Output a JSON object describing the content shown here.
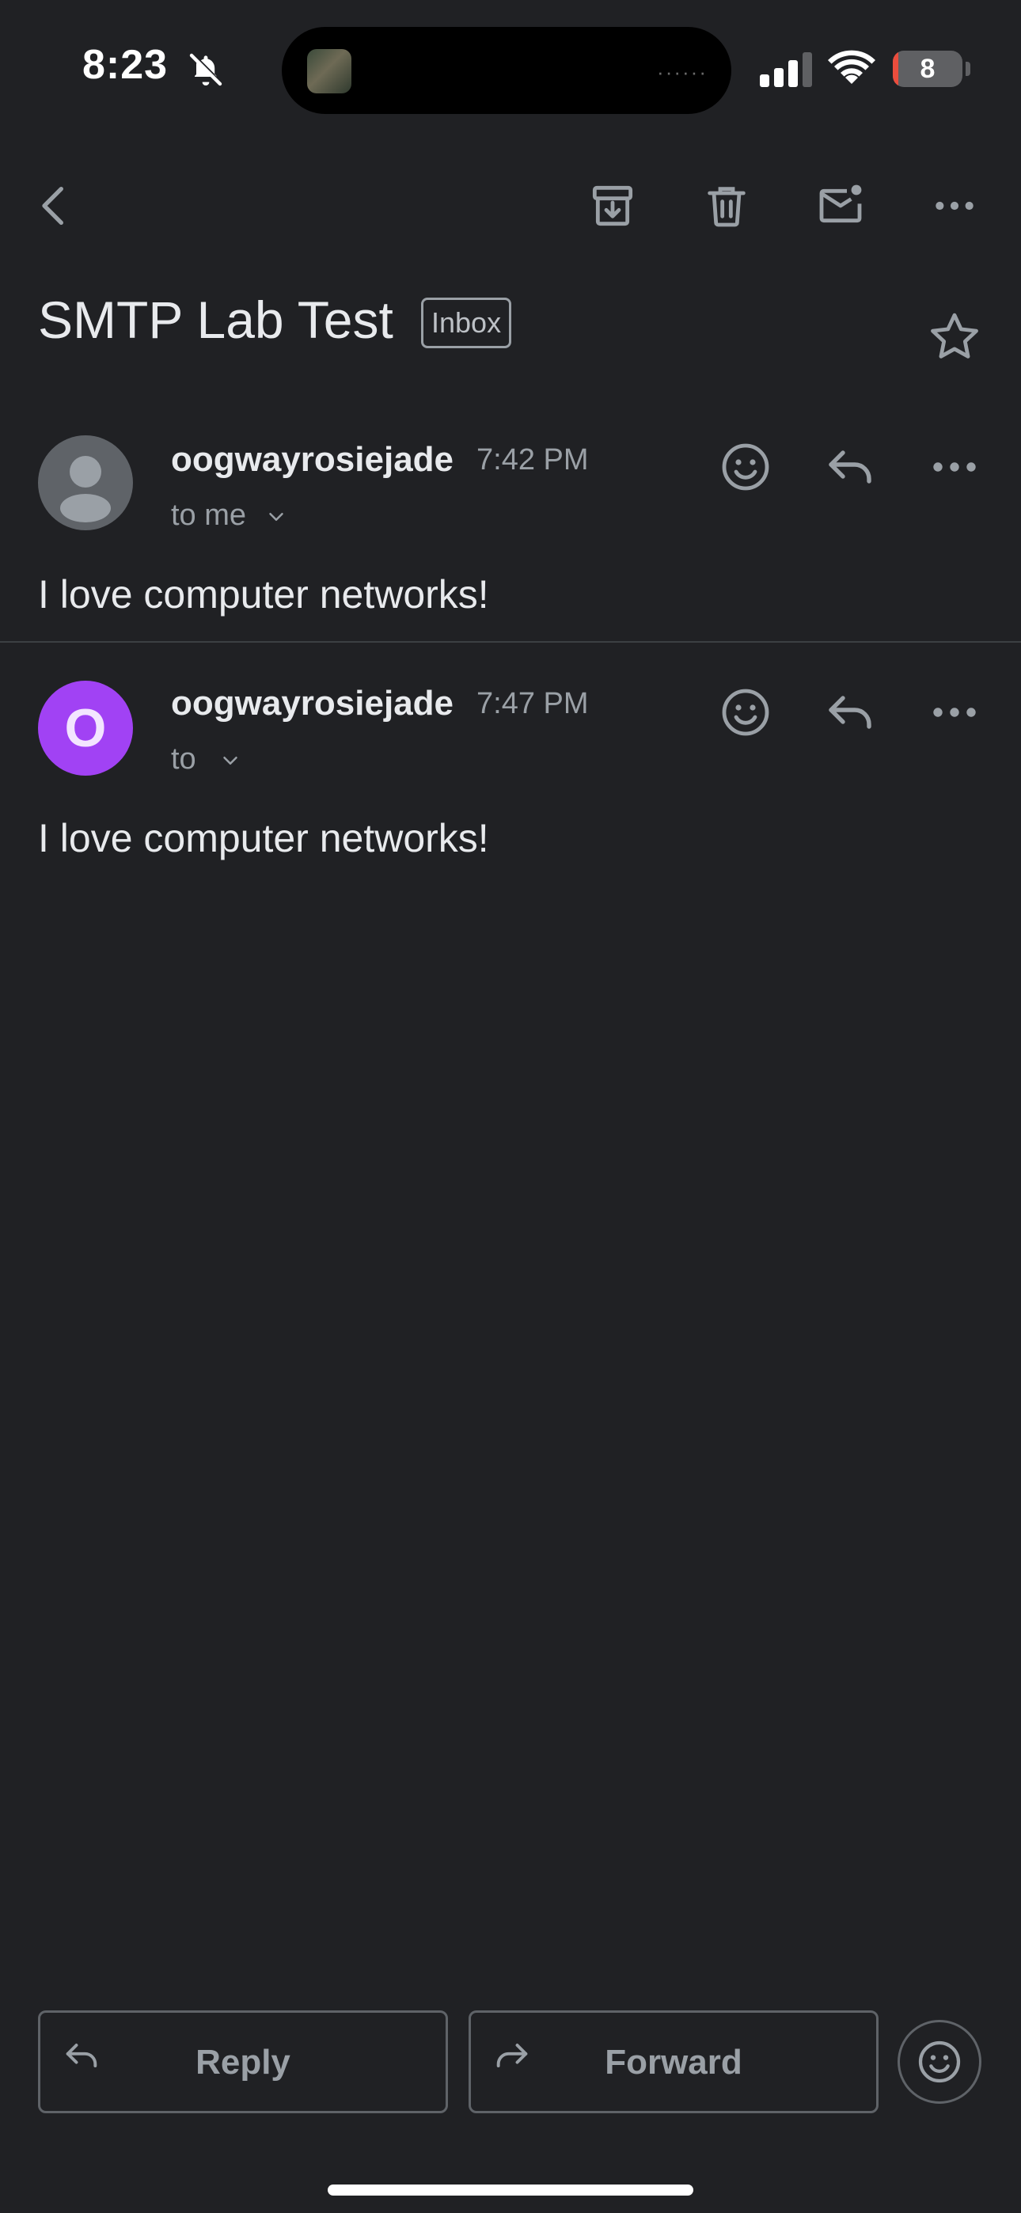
{
  "status_bar": {
    "time": "8:23",
    "battery_level": "8",
    "battery_fraction": 0.08,
    "icons": [
      "bell-slash-icon",
      "signal-icon",
      "wifi-icon",
      "battery-icon"
    ]
  },
  "toolbar": {
    "icons": [
      "back-icon",
      "archive-icon",
      "trash-icon",
      "mark-unread-icon",
      "more-icon"
    ]
  },
  "subject": {
    "title": "SMTP Lab Test",
    "label": "Inbox"
  },
  "messages": [
    {
      "sender": "oogwayrosiejade",
      "time": "7:42 PM",
      "recipient": "to me",
      "body": "I love computer networks!",
      "avatar_letter": ""
    },
    {
      "sender": "oogwayrosiejade",
      "time": "7:47 PM",
      "recipient": "to",
      "body": "I love computer networks!",
      "avatar_letter": "O"
    }
  ],
  "bottom": {
    "reply_label": "Reply",
    "forward_label": "Forward"
  },
  "colors": {
    "background": "#202124",
    "avatar_purple": "#a142f4",
    "battery_low": "#eb4d3d"
  }
}
